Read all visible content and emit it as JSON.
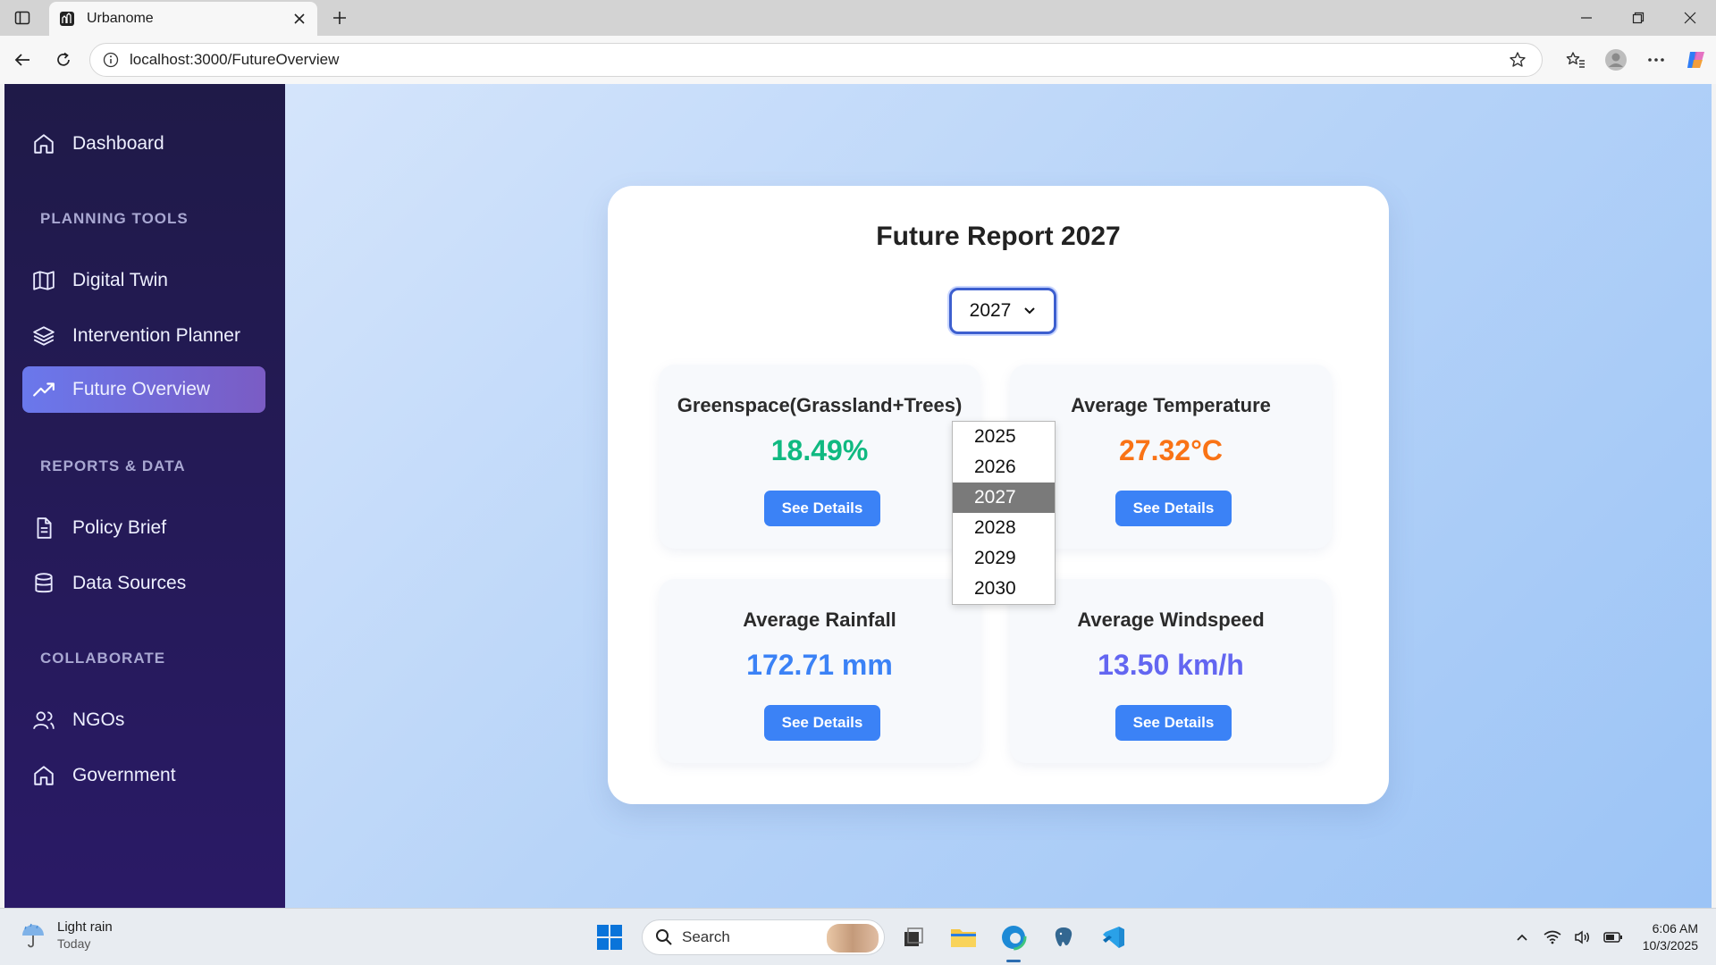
{
  "browser": {
    "tab_title": "Urbanome",
    "url": "localhost:3000/FutureOverview"
  },
  "sidebar": {
    "items": [
      {
        "label": "Dashboard",
        "icon": "home-icon"
      },
      {
        "label": "Digital Twin",
        "icon": "map-icon"
      },
      {
        "label": "Intervention Planner",
        "icon": "layers-icon"
      },
      {
        "label": "Future Overview",
        "icon": "trending-up-icon",
        "active": true
      },
      {
        "label": "Policy Brief",
        "icon": "document-icon"
      },
      {
        "label": "Data Sources",
        "icon": "database-icon"
      },
      {
        "label": "NGOs",
        "icon": "users-icon"
      },
      {
        "label": "Government",
        "icon": "building-icon"
      }
    ],
    "sections": [
      "PLANNING TOOLS",
      "REPORTS & DATA",
      "COLLABORATE"
    ]
  },
  "report": {
    "title": "Future Report 2027",
    "selected_year": "2027",
    "year_options": [
      "2025",
      "2026",
      "2027",
      "2028",
      "2029",
      "2030"
    ],
    "metrics": [
      {
        "label": "Greenspace(Grassland+Trees)",
        "value": "18.49%",
        "color": "#10b981",
        "button": "See Details"
      },
      {
        "label": "Average Temperature",
        "value": "27.32°C",
        "color": "#f97316",
        "button": "See Details"
      },
      {
        "label": "Average Rainfall",
        "value": "172.71 mm",
        "color": "#3b82f6",
        "button": "See Details"
      },
      {
        "label": "Average Windspeed",
        "value": "13.50 km/h",
        "color": "#6366f1",
        "button": "See Details"
      }
    ]
  },
  "taskbar": {
    "weather_main": "Light rain",
    "weather_sub": "Today",
    "search_placeholder": "Search",
    "time": "6:06 AM",
    "date": "10/3/2025"
  },
  "colors": {
    "sidebar_bg": "#1f1a48",
    "active_nav": "#6a78ec",
    "button": "#3b82f6"
  }
}
